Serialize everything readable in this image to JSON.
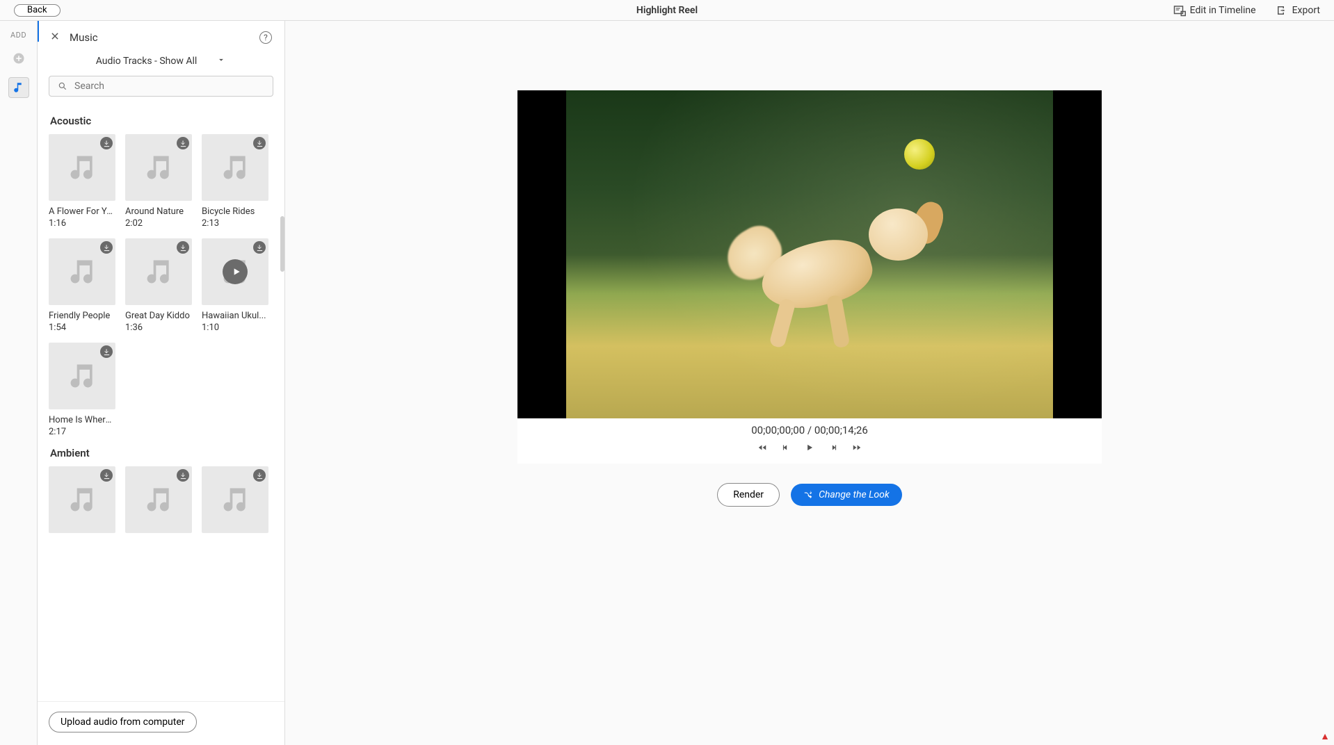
{
  "topbar": {
    "back_label": "Back",
    "title": "Highlight Reel",
    "edit_timeline": "Edit in Timeline",
    "export": "Export"
  },
  "leftrail": {
    "add_label": "ADD"
  },
  "panel": {
    "title": "Music",
    "filter_label": "Audio Tracks - Show All",
    "search_placeholder": "Search",
    "upload_label": "Upload audio from computer",
    "categories": [
      {
        "name": "Acoustic",
        "tracks": [
          {
            "title": "A Flower For You",
            "duration": "1:16",
            "hover": false
          },
          {
            "title": "Around Nature",
            "duration": "2:02",
            "hover": false
          },
          {
            "title": "Bicycle Rides",
            "duration": "2:13",
            "hover": false
          },
          {
            "title": "Friendly People",
            "duration": "1:54",
            "hover": false
          },
          {
            "title": "Great Day Kiddo",
            "duration": "1:36",
            "hover": false
          },
          {
            "title": "Hawaiian Ukul...",
            "duration": "1:10",
            "hover": true
          },
          {
            "title": "Home Is Where...",
            "duration": "2:17",
            "hover": false
          }
        ]
      },
      {
        "name": "Ambient",
        "tracks": [
          {
            "title": "",
            "duration": "",
            "hover": false
          },
          {
            "title": "",
            "duration": "",
            "hover": false
          },
          {
            "title": "",
            "duration": "",
            "hover": false
          }
        ]
      }
    ]
  },
  "preview": {
    "timecode_current": "00;00;00;00",
    "timecode_sep": " / ",
    "timecode_total": "00;00;14;26",
    "render_label": "Render",
    "change_look_label": "Change the Look"
  }
}
